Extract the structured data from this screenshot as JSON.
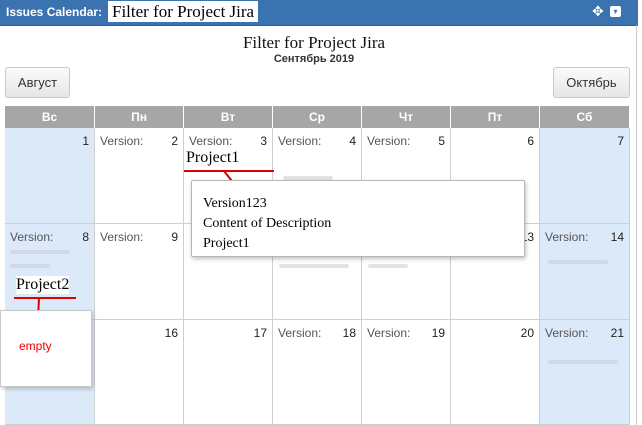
{
  "titlebar": {
    "label": "Issues Calendar:",
    "filter_name": "Filter for Project Jira",
    "move_icon": "✥",
    "menu_icon": "▾"
  },
  "calendar": {
    "title": "Filter for Project Jira",
    "subtitle": "Сентябрь 2019",
    "prev_label": "Август",
    "next_label": "Октябрь",
    "weekdays": [
      "Вс",
      "Пн",
      "Вт",
      "Ср",
      "Чт",
      "Пт",
      "Сб"
    ],
    "version_label": "Version:",
    "days": {
      "d1": "1",
      "d2": "2",
      "d3": "3",
      "d4": "4",
      "d5": "5",
      "d6": "6",
      "d7": "7",
      "d8": "8",
      "d9": "9",
      "d13": "13",
      "d14": "14",
      "d16": "16",
      "d17": "17",
      "d18": "18",
      "d19": "19",
      "d20": "20",
      "d21": "21"
    }
  },
  "annotations": {
    "event1": "Project1",
    "event2": "Project2",
    "empty_note": "empty"
  },
  "tooltip": {
    "line1": "Version123",
    "line2": "Content of Description",
    "line3": "Project1"
  },
  "colors": {
    "header": "#3b72b0",
    "weekend": "#dce9f9",
    "weekday_header": "#a6a6a6",
    "annotation": "#dd0000"
  }
}
